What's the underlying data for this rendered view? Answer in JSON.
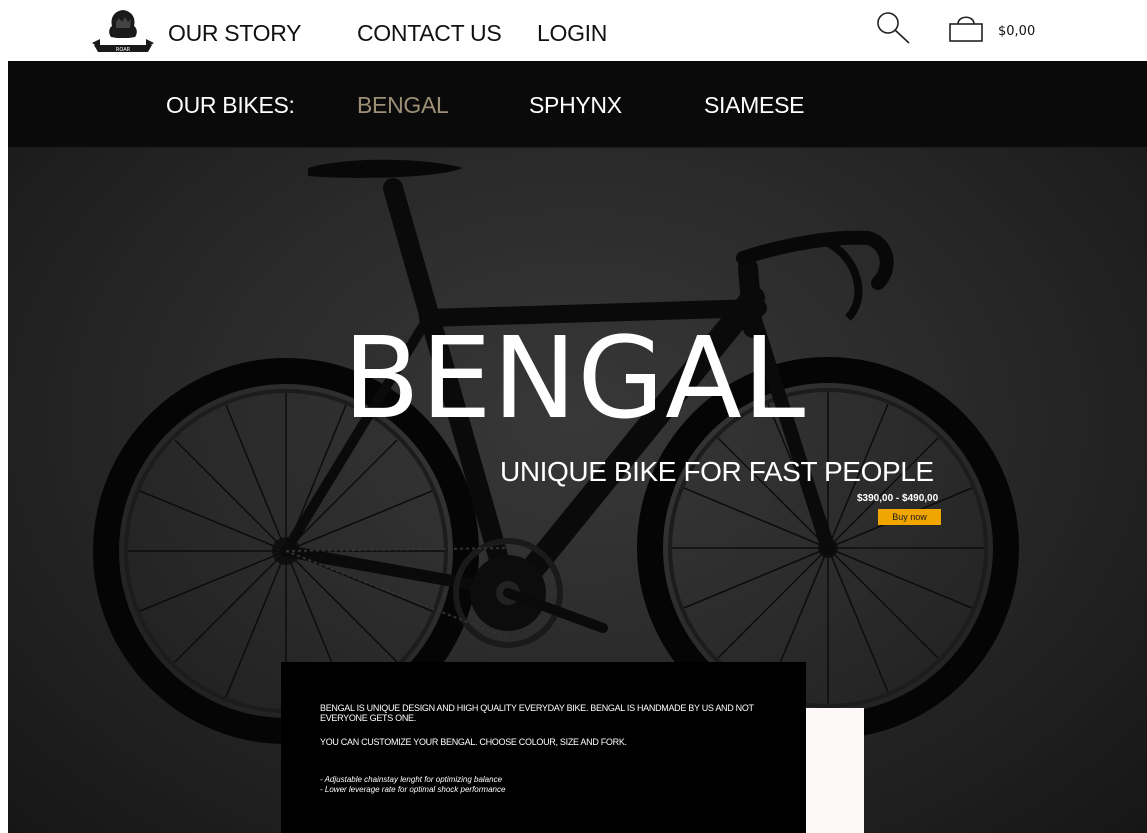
{
  "header": {
    "logo_text": "ROAR",
    "nav": [
      {
        "label": "OUR STORY"
      },
      {
        "label": "CONTACT US"
      },
      {
        "label": "LOGIN"
      }
    ],
    "cart_total": "$0,00",
    "icons": {
      "search": "search-icon",
      "cart": "shopping-bag-icon"
    }
  },
  "bikes_nav": {
    "label": "OUR BIKES:",
    "tabs": [
      {
        "label": "BENGAL",
        "active": true
      },
      {
        "label": "SPHYNX",
        "active": false
      },
      {
        "label": "SIAMESE",
        "active": false
      }
    ],
    "active_color": "#9c8f76"
  },
  "hero": {
    "title": "BENGAL",
    "tagline": "UNIQUE BIKE FOR FAST PEOPLE",
    "price_range": "$390,00 - $490,00",
    "buy_label": "Buy now",
    "buy_color": "#f0a500"
  },
  "description": {
    "paragraph_1": "BENGAL IS UNIQUE DESIGN AND HIGH QUALITY EVERYDAY BIKE.  BENGAL IS HANDMADE BY US AND NOT EVERYONE GETS ONE.",
    "paragraph_2": "YOU CAN CUSTOMIZE YOUR BENGAL. CHOOSE COLOUR, SIZE AND FORK.",
    "features": [
      "- Adjustable chainstay lenght for optimizing balance",
      "- Lower leverage rate for optimal shock performance"
    ]
  }
}
